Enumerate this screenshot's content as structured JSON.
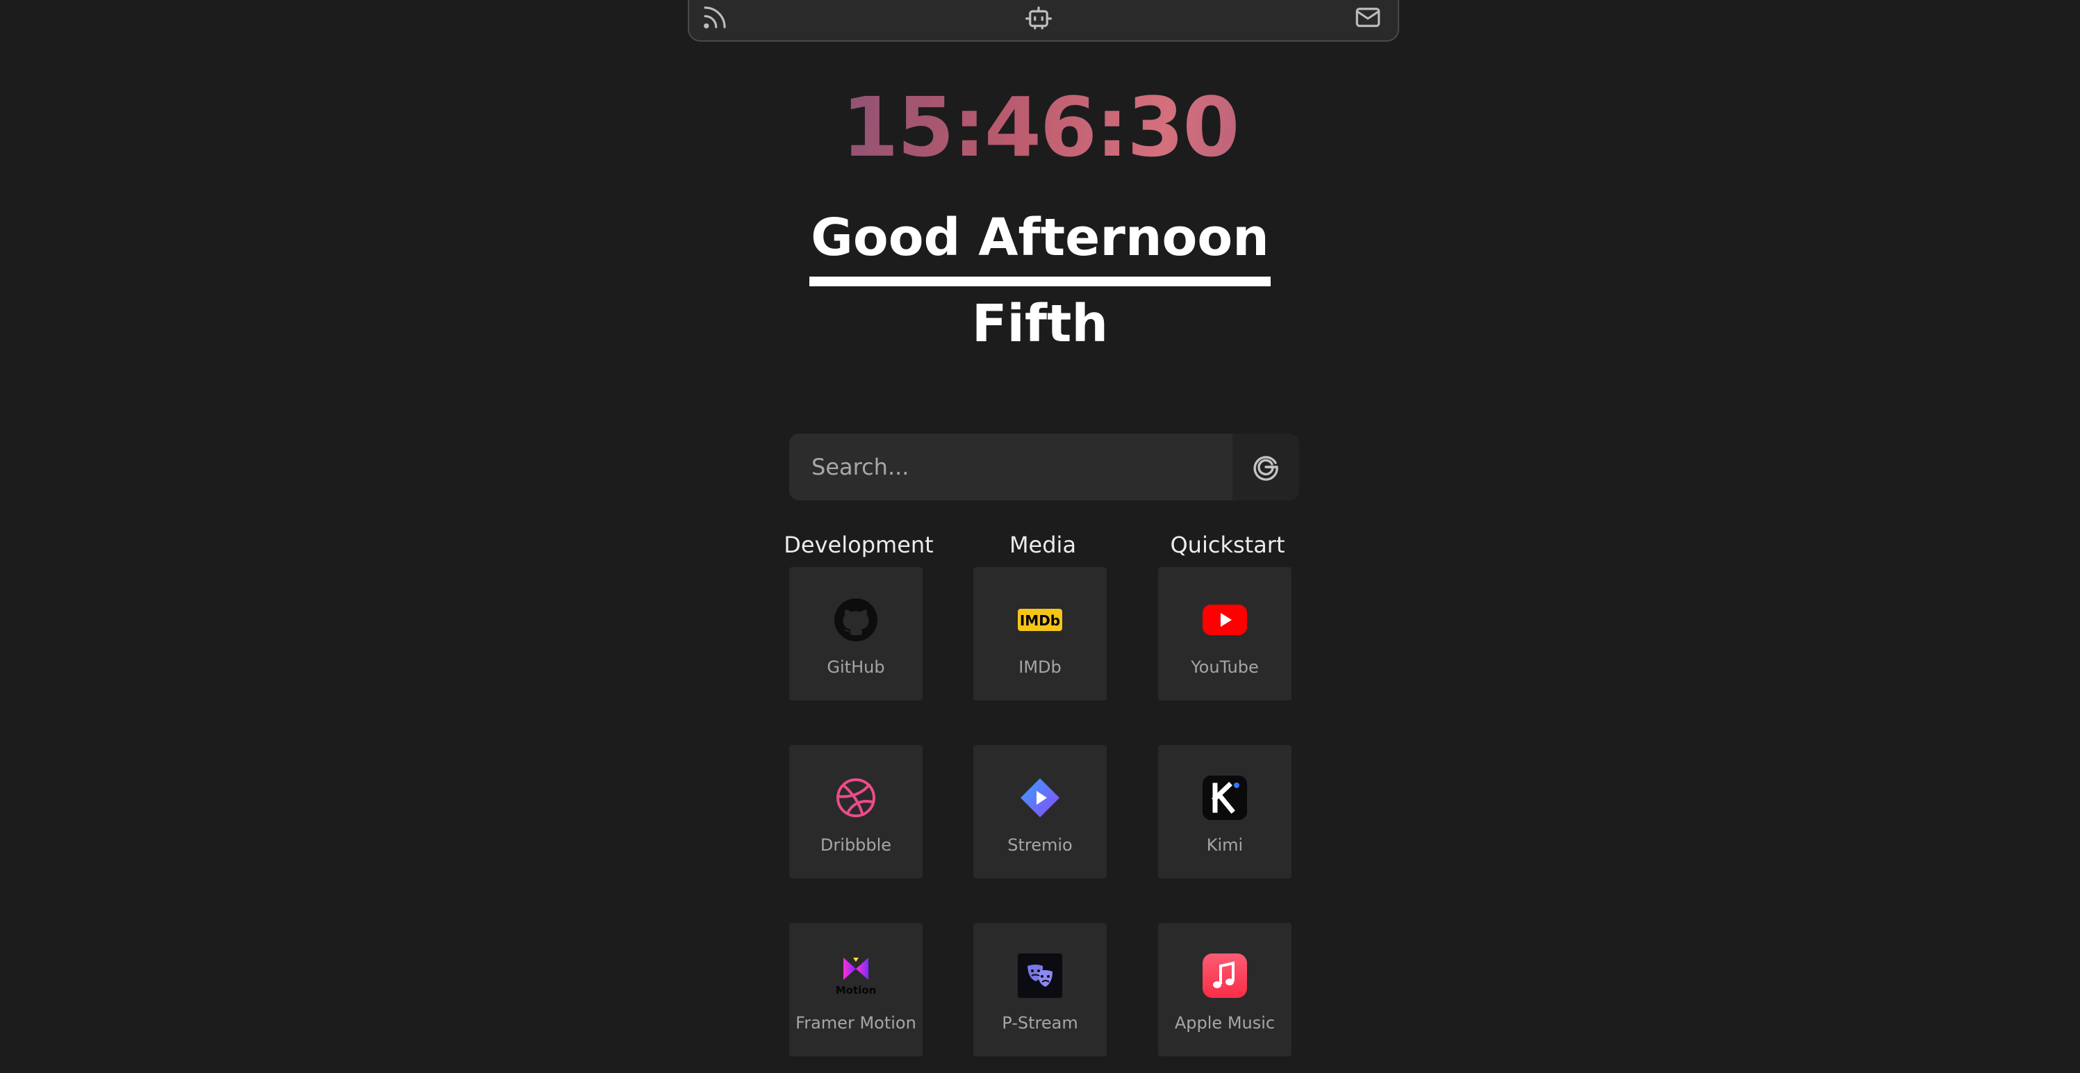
{
  "topbar": {
    "icons": [
      "rss-icon",
      "bot-icon",
      "mail-icon"
    ]
  },
  "clock": {
    "time": "15:46:30"
  },
  "greeting": {
    "message": "Good Afternoon",
    "name": "Fifth"
  },
  "search": {
    "placeholder": "Search...",
    "engine_icon": "google-icon"
  },
  "categories": [
    "Development",
    "Media",
    "Quickstart"
  ],
  "tiles": [
    {
      "label": "GitHub",
      "icon": "github-icon"
    },
    {
      "label": "IMDb",
      "icon": "imdb-icon"
    },
    {
      "label": "YouTube",
      "icon": "youtube-icon"
    },
    {
      "label": "Dribbble",
      "icon": "dribbble-icon"
    },
    {
      "label": "Stremio",
      "icon": "stremio-icon"
    },
    {
      "label": "Kimi",
      "icon": "kimi-icon"
    },
    {
      "label": "Framer Motion",
      "icon": "framer-motion-icon"
    },
    {
      "label": "P-Stream",
      "icon": "p-stream-icon"
    },
    {
      "label": "Apple Music",
      "icon": "apple-music-icon"
    }
  ],
  "colors": {
    "background": "#1c1c1d",
    "tile": "#2a2a2b",
    "imdb": "#f5c518",
    "youtube": "#ff0000",
    "dribbble": "#ea4c89",
    "stremio": "#7b5bf5",
    "apple_music": "#fa2d48"
  }
}
